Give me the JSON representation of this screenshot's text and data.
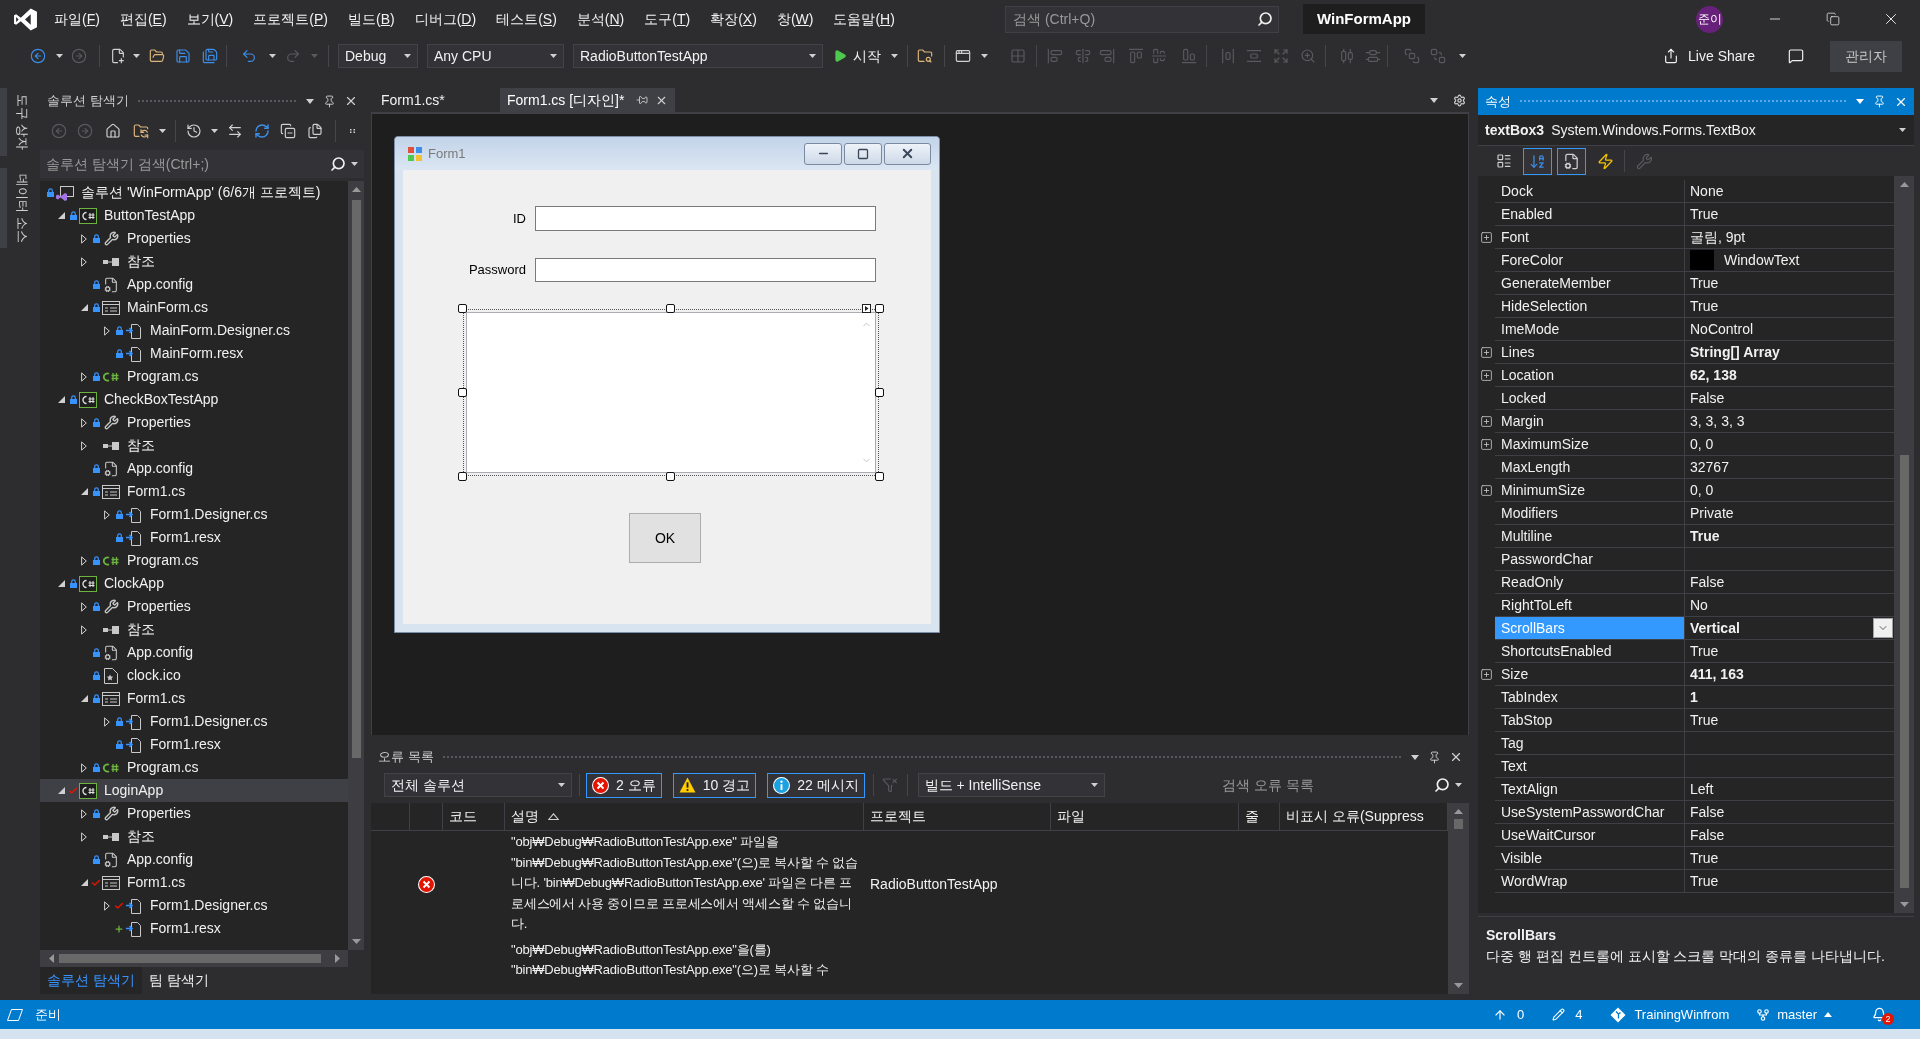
{
  "title_bar": {
    "menu": [
      "파일(F)",
      "편집(E)",
      "보기(V)",
      "프로젝트(P)",
      "빌드(B)",
      "디버그(D)",
      "테스트(S)",
      "분석(N)",
      "도구(T)",
      "확장(X)",
      "창(W)",
      "도움말(H)"
    ],
    "search": {
      "placeholder": "검색 (Ctrl+Q)"
    },
    "solution_name": "WinFormApp",
    "user_initials": "준이"
  },
  "toolbar": {
    "configuration": "Debug",
    "platform": "Any CPU",
    "startup_project": "RadioButtonTestApp",
    "start_label": "시작",
    "live_share": "Live Share",
    "admin_label": "관리자"
  },
  "side_tabs": [
    "도구 상자",
    "데이터 소스"
  ],
  "solution_explorer": {
    "title": "솔루션 탐색기",
    "focused": false,
    "search": {
      "placeholder": "솔루션 탐색기 검색(Ctrl+;)"
    },
    "tree": [
      {
        "label": "솔루션 'WinFormApp' (6/6개 프로젝트)",
        "kind": "solution",
        "locked": true,
        "checked_out": false,
        "added": false,
        "selected": false,
        "children": [
          {
            "label": "ButtonTestApp",
            "kind": "project",
            "locked": true,
            "checked_out": false,
            "added": false,
            "expanded": true,
            "selected": false,
            "children": [
              {
                "label": "Properties",
                "kind": "properties",
                "locked": true,
                "checked_out": false,
                "added": false,
                "expanded": false,
                "selected": false
              },
              {
                "label": "참조",
                "kind": "references",
                "locked": false,
                "checked_out": false,
                "added": false,
                "expanded": false,
                "selected": false
              },
              {
                "label": "App.config",
                "kind": "config",
                "locked": true,
                "checked_out": false,
                "added": false,
                "selected": false
              },
              {
                "label": "MainForm.cs",
                "kind": "form",
                "locked": true,
                "checked_out": false,
                "added": false,
                "expanded": true,
                "selected": false,
                "children": [
                  {
                    "label": "MainForm.Designer.cs",
                    "kind": "linked",
                    "locked": true,
                    "checked_out": false,
                    "added": false,
                    "expanded": false,
                    "selected": false
                  },
                  {
                    "label": "MainForm.resx",
                    "kind": "linked",
                    "locked": true,
                    "checked_out": false,
                    "added": false,
                    "selected": false
                  }
                ]
              },
              {
                "label": "Program.cs",
                "kind": "csharp",
                "locked": true,
                "checked_out": false,
                "added": false,
                "expanded": false,
                "selected": false
              }
            ]
          },
          {
            "label": "CheckBoxTestApp",
            "kind": "project",
            "locked": true,
            "checked_out": false,
            "added": false,
            "expanded": true,
            "selected": false,
            "children": [
              {
                "label": "Properties",
                "kind": "properties",
                "locked": true,
                "checked_out": false,
                "added": false,
                "expanded": false,
                "selected": false
              },
              {
                "label": "참조",
                "kind": "references",
                "locked": false,
                "checked_out": false,
                "added": false,
                "expanded": false,
                "selected": false
              },
              {
                "label": "App.config",
                "kind": "config",
                "locked": true,
                "checked_out": false,
                "added": false,
                "selected": false
              },
              {
                "label": "Form1.cs",
                "kind": "form",
                "locked": true,
                "checked_out": false,
                "added": false,
                "expanded": true,
                "selected": false,
                "children": [
                  {
                    "label": "Form1.Designer.cs",
                    "kind": "linked",
                    "locked": true,
                    "checked_out": false,
                    "added": false,
                    "expanded": false,
                    "selected": false
                  },
                  {
                    "label": "Form1.resx",
                    "kind": "linked",
                    "locked": true,
                    "checked_out": false,
                    "added": false,
                    "selected": false
                  }
                ]
              },
              {
                "label": "Program.cs",
                "kind": "csharp",
                "locked": true,
                "checked_out": false,
                "added": false,
                "expanded": false,
                "selected": false
              }
            ]
          },
          {
            "label": "ClockApp",
            "kind": "project",
            "locked": true,
            "checked_out": false,
            "added": false,
            "expanded": true,
            "selected": false,
            "children": [
              {
                "label": "Properties",
                "kind": "properties",
                "locked": true,
                "checked_out": false,
                "added": false,
                "expanded": false,
                "selected": false
              },
              {
                "label": "참조",
                "kind": "references",
                "locked": false,
                "checked_out": false,
                "added": false,
                "expanded": false,
                "selected": false
              },
              {
                "label": "App.config",
                "kind": "config",
                "locked": true,
                "checked_out": false,
                "added": false,
                "selected": false
              },
              {
                "label": "clock.ico",
                "kind": "image",
                "locked": true,
                "checked_out": false,
                "added": false,
                "selected": false
              },
              {
                "label": "Form1.cs",
                "kind": "form",
                "locked": true,
                "checked_out": false,
                "added": false,
                "expanded": true,
                "selected": false,
                "children": [
                  {
                    "label": "Form1.Designer.cs",
                    "kind": "linked",
                    "locked": true,
                    "checked_out": false,
                    "added": false,
                    "expanded": false,
                    "selected": false
                  },
                  {
                    "label": "Form1.resx",
                    "kind": "linked",
                    "locked": true,
                    "checked_out": false,
                    "added": false,
                    "selected": false
                  }
                ]
              },
              {
                "label": "Program.cs",
                "kind": "csharp",
                "locked": true,
                "checked_out": false,
                "added": false,
                "expanded": false,
                "selected": false
              }
            ]
          },
          {
            "label": "LoginApp",
            "kind": "project",
            "locked": false,
            "checked_out": true,
            "added": false,
            "expanded": true,
            "selected": true,
            "children": [
              {
                "label": "Properties",
                "kind": "properties",
                "locked": true,
                "checked_out": false,
                "added": false,
                "expanded": false,
                "selected": false
              },
              {
                "label": "참조",
                "kind": "references",
                "locked": false,
                "checked_out": false,
                "added": false,
                "expanded": false,
                "selected": false
              },
              {
                "label": "App.config",
                "kind": "config",
                "locked": true,
                "checked_out": false,
                "added": false,
                "selected": false
              },
              {
                "label": "Form1.cs",
                "kind": "form",
                "locked": false,
                "checked_out": true,
                "added": false,
                "expanded": true,
                "selected": false,
                "children": [
                  {
                    "label": "Form1.Designer.cs",
                    "kind": "linked",
                    "locked": false,
                    "checked_out": true,
                    "added": false,
                    "expanded": false,
                    "selected": false
                  },
                  {
                    "label": "Form1.resx",
                    "kind": "linked",
                    "locked": false,
                    "checked_out": false,
                    "added": true,
                    "selected": false
                  }
                ]
              }
            ]
          }
        ]
      }
    ],
    "tabs": [
      {
        "label": "솔루션 탐색기",
        "selected": true
      },
      {
        "label": "팀 탐색기",
        "selected": false
      }
    ]
  },
  "editor": {
    "tabs": [
      {
        "label": "Form1.cs*",
        "selected": false
      },
      {
        "label": "Form1.cs [디자인]*",
        "selected": true
      }
    ],
    "form": {
      "title": "Form1",
      "fields": [
        {
          "label": "ID"
        },
        {
          "label": "Password"
        }
      ],
      "memo": {
        "selected": true,
        "vertical_scrollbar": true
      },
      "button": "OK"
    }
  },
  "error_list": {
    "title": "오류 목록",
    "focused": false,
    "scope": "전체 솔루션",
    "filters": [
      {
        "kind": "error",
        "label": "2 오류",
        "on": true
      },
      {
        "kind": "warning",
        "label": "10 경고",
        "on": true
      },
      {
        "kind": "message",
        "label": "22 메시지",
        "on": true
      }
    ],
    "source": "빌드 + IntelliSense",
    "search": {
      "placeholder": "검색 오류 목록"
    },
    "columns": [
      {
        "label": "코드",
        "sorted": false
      },
      {
        "label": "설명",
        "sorted": true
      },
      {
        "label": "프로젝트",
        "sorted": false
      },
      {
        "label": "파일",
        "sorted": false
      },
      {
        "label": "줄",
        "sorted": false
      },
      {
        "label": "비표시 오류(Suppress",
        "sorted": false
      }
    ],
    "rows": [
      {
        "kind": "error",
        "description": "\"obj₩Debug₩RadioButtonTestApp.exe\" 파일을 \"bin₩Debug₩RadioButtonTestApp.exe\"(으)로 복사할 수 없습니다. 'bin₩Debug₩RadioButtonTestApp.exe' 파일은 다른 프로세스에서 사용 중이므로 프로세스에서 액세스할 수 없습니다.",
        "project": "RadioButtonTestApp"
      },
      {
        "description": "\"obj₩Debug₩RadioButtonTestApp.exe\"을(를) \"bin₩Debug₩RadioButtonTestApp.exe\"(으)로 복사할 수"
      }
    ]
  },
  "properties": {
    "title": "속성",
    "focused": true,
    "object_name": "textBox3",
    "object_type": "System.Windows.Forms.TextBox",
    "view_buttons": [
      {
        "kind": "categorized",
        "selected": false,
        "disabled": false
      },
      {
        "kind": "alphabetical",
        "selected": true,
        "disabled": false
      },
      {
        "kind": "properties",
        "selected": true,
        "disabled": false
      },
      {
        "kind": "events",
        "selected": false,
        "disabled": false
      },
      {
        "kind": "property_pages",
        "selected": false,
        "disabled": true
      }
    ],
    "rows": [
      {
        "name": "Dock",
        "value": "None",
        "expandable": false,
        "modified": false,
        "selected": false
      },
      {
        "name": "Enabled",
        "value": "True",
        "expandable": false,
        "modified": false,
        "selected": false
      },
      {
        "name": "Font",
        "value": "굴림, 9pt",
        "expandable": true,
        "modified": false,
        "selected": false
      },
      {
        "name": "ForeColor",
        "value": "WindowText",
        "color": "#000000",
        "expandable": false,
        "modified": false,
        "selected": false
      },
      {
        "name": "GenerateMember",
        "value": "True",
        "expandable": false,
        "modified": false,
        "selected": false
      },
      {
        "name": "HideSelection",
        "value": "True",
        "expandable": false,
        "modified": false,
        "selected": false
      },
      {
        "name": "ImeMode",
        "value": "NoControl",
        "expandable": false,
        "modified": false,
        "selected": false
      },
      {
        "name": "Lines",
        "value": "String[] Array",
        "expandable": true,
        "modified": true,
        "selected": false
      },
      {
        "name": "Location",
        "value": "62, 138",
        "expandable": true,
        "modified": true,
        "selected": false
      },
      {
        "name": "Locked",
        "value": "False",
        "expandable": false,
        "modified": false,
        "selected": false
      },
      {
        "name": "Margin",
        "value": "3, 3, 3, 3",
        "expandable": true,
        "modified": false,
        "selected": false
      },
      {
        "name": "MaximumSize",
        "value": "0, 0",
        "expandable": true,
        "modified": false,
        "selected": false
      },
      {
        "name": "MaxLength",
        "value": "32767",
        "expandable": false,
        "modified": false,
        "selected": false
      },
      {
        "name": "MinimumSize",
        "value": "0, 0",
        "expandable": true,
        "modified": false,
        "selected": false
      },
      {
        "name": "Modifiers",
        "value": "Private",
        "expandable": false,
        "modified": false,
        "selected": false
      },
      {
        "name": "Multiline",
        "value": "True",
        "expandable": false,
        "modified": true,
        "selected": false
      },
      {
        "name": "PasswordChar",
        "expandable": false,
        "selected": false
      },
      {
        "name": "ReadOnly",
        "value": "False",
        "expandable": false,
        "modified": false,
        "selected": false
      },
      {
        "name": "RightToLeft",
        "value": "No",
        "expandable": false,
        "modified": false,
        "selected": false
      },
      {
        "name": "ScrollBars",
        "value": "Vertical",
        "expandable": false,
        "modified": true,
        "selected": true
      },
      {
        "name": "ShortcutsEnabled",
        "value": "True",
        "expandable": false,
        "modified": false,
        "selected": false
      },
      {
        "name": "Size",
        "value": "411, 163",
        "expandable": true,
        "modified": true,
        "selected": false
      },
      {
        "name": "TabIndex",
        "value": "1",
        "expandable": false,
        "modified": true,
        "selected": false
      },
      {
        "name": "TabStop",
        "value": "True",
        "expandable": false,
        "modified": false,
        "selected": false
      },
      {
        "name": "Tag",
        "expandable": false,
        "selected": false
      },
      {
        "name": "Text",
        "expandable": false,
        "selected": false
      },
      {
        "name": "TextAlign",
        "value": "Left",
        "expandable": false,
        "modified": false,
        "selected": false
      },
      {
        "name": "UseSystemPasswordChar",
        "value": "False",
        "expandable": false,
        "modified": false,
        "selected": false
      },
      {
        "name": "UseWaitCursor",
        "value": "False",
        "expandable": false,
        "modified": false,
        "selected": false
      },
      {
        "name": "Visible",
        "value": "True",
        "expandable": false,
        "modified": false,
        "selected": false
      },
      {
        "name": "WordWrap",
        "value": "True",
        "expandable": false,
        "modified": false,
        "selected": false
      }
    ],
    "description": {
      "title": "ScrollBars",
      "text": "다중 행 편집 컨트롤에 표시할 스크롤 막대의 종류를 나타냅니다."
    }
  },
  "status_bar": {
    "text": "준비",
    "outgoing": "0",
    "pending": "4",
    "repository": "TrainingWinfrom",
    "branch": "master",
    "notifications": "2"
  }
}
